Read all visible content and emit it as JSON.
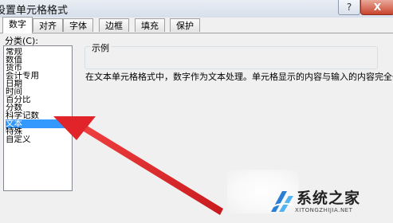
{
  "window": {
    "title": "设置单元格格式",
    "help_glyph": "?",
    "close_glyph": "X"
  },
  "tabs": [
    {
      "label": "数字",
      "active": true
    },
    {
      "label": "对齐",
      "active": false
    },
    {
      "label": "字体",
      "active": false
    },
    {
      "label": "边框",
      "active": false
    },
    {
      "label": "填充",
      "active": false
    },
    {
      "label": "保护",
      "active": false
    }
  ],
  "category": {
    "label": "分类(C):",
    "items": [
      {
        "label": "常规",
        "selected": false
      },
      {
        "label": "数值",
        "selected": false
      },
      {
        "label": "货币",
        "selected": false
      },
      {
        "label": "会计专用",
        "selected": false
      },
      {
        "label": "日期",
        "selected": false
      },
      {
        "label": "时间",
        "selected": false
      },
      {
        "label": "百分比",
        "selected": false
      },
      {
        "label": "分数",
        "selected": false
      },
      {
        "label": "科学记数",
        "selected": false
      },
      {
        "label": "文本",
        "selected": true
      },
      {
        "label": "特殊",
        "selected": false
      },
      {
        "label": "自定义",
        "selected": false
      }
    ]
  },
  "sample": {
    "label": "示例",
    "value": ""
  },
  "description": "在文本单元格格式中，数字作为文本处理。单元格显示的内容与输入的内容完全一致。",
  "watermark": {
    "brand": "系统之家",
    "url": "XITONGZHIJIA.NET"
  },
  "colors": {
    "arrow": "#e0242a",
    "selection": "#3399ff",
    "close_button": "#c8442c"
  }
}
